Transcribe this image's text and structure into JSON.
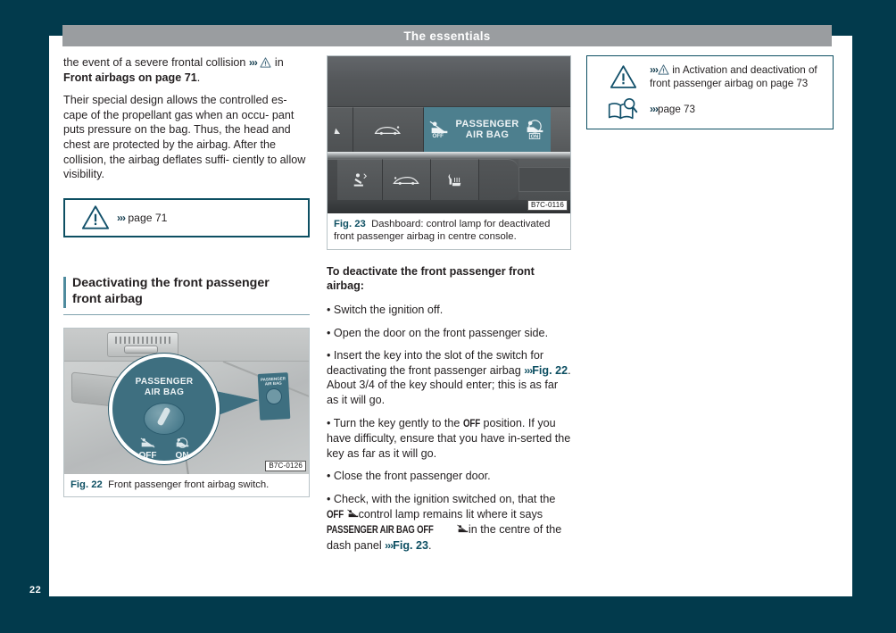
{
  "header": {
    "title": "The essentials"
  },
  "footer": {
    "page_number": "22"
  },
  "colors": {
    "page_background": "#023a4c",
    "paper": "#ffffff",
    "header_band": "#9a9da0",
    "accent_teal": "#0d4f62",
    "heading_rule": "#7fa2ad",
    "lamp_teal": "#4d7f8e"
  },
  "left_column": {
    "paragraphs": [
      {
        "id": "p1",
        "parts": [
          {
            "type": "text",
            "value": "the event of a severe frontal collision "
          },
          {
            "type": "chevron",
            "value": "›››"
          },
          {
            "type": "icon",
            "name": "warning-triangle-icon"
          },
          {
            "type": "text",
            "value": " in "
          },
          {
            "type": "bold",
            "value": "Front airbags on page 71"
          },
          {
            "type": "text",
            "value": "."
          }
        ],
        "plain": "the event of a severe frontal collision ››› ⚠ in Front airbags on page 71."
      },
      {
        "id": "p2",
        "plain": "Their special design allows the controlled es-cape of the propellant gas when an occu-pant puts pressure on the bag. Thus, the head and chest are protected by the airbag. After the collision, the airbag deflates suffi-ciently to allow visibility."
      }
    ],
    "p2_lines": [
      "Their special design allows the controlled es-",
      "cape of the propellant gas when an occu-",
      "pant puts pressure on the bag. Thus, the",
      "head and chest are protected by the airbag.",
      "After the collision, the airbag deflates suffi-",
      "ciently to allow visibility."
    ],
    "warning_box": {
      "icon": "warning-triangle-icon",
      "chevron": "›››",
      "text": "page 71"
    },
    "section_heading": {
      "line1": "Deactivating the front passenger",
      "line2": "front airbag"
    },
    "figure_22": {
      "code_tag": "B7C-0126",
      "caption_number": "Fig. 22",
      "caption_text": "Front passenger front airbag switch.",
      "artwork": {
        "callout_title_line1": "PASSENGER",
        "callout_title_line2": "AIR BAG",
        "label_off": "OFF",
        "label_on": "ON",
        "mini_switch_line1": "PASSENGER",
        "mini_switch_line2": "AIR BAG"
      }
    }
  },
  "middle_column": {
    "figure_23": {
      "code_tag": "B7C-0116",
      "caption_number": "Fig. 23",
      "caption_text": "Dashboard: control lamp for deactivated front passenger airbag in centre console.",
      "artwork": {
        "lamp_line1": "PASSENGER",
        "lamp_line2": "AIR BAG",
        "lamp_off_badge": "OFF",
        "lamp_on_badge": "ON",
        "row1_buttons": [
          "hazard-icon",
          "boot-lid-icon"
        ],
        "row2_buttons": [
          "child-seat-icon",
          "bonnet-icon",
          "seat-heater-icon",
          "blank-button"
        ]
      }
    },
    "intro_heading_line1": "To deactivate the front passenger front",
    "intro_heading_line2": "airbag:",
    "bullets": [
      {
        "id": "b1",
        "text": "Switch the ignition off."
      },
      {
        "id": "b2",
        "text": "Open the door on the front passenger side."
      },
      {
        "id": "b3",
        "text": "Insert the key into the slot of the switch for deactivating the front passenger airbag ››› Fig. 22. About 3/4 of the key should enter; this is as far as it will go.",
        "link": "Fig. 22"
      },
      {
        "id": "b4",
        "text": "Turn the key gently to the OFF position. If you have difficulty, ensure that you have inserted the key as far as it will go.",
        "chip": "OFF"
      },
      {
        "id": "b5",
        "text": "Close the front passenger door."
      },
      {
        "id": "b6",
        "text": "Check, with the ignition switched on, that the OFF ⚠ control lamp remains lit where it says PASSENGER AIR BAG OFF ⚠ in the centre of the dash panel ››› Fig. 23.",
        "chip": "OFF",
        "chip2": "PASSENGER AIR BAG OFF",
        "link": "Fig. 23"
      }
    ],
    "bullet_marker": "•",
    "chip_off": "OFF",
    "chip_pab_off": "PASSENGER AIR BAG OFF",
    "link_fig22": "Fig. 22",
    "link_fig23": "Fig. 23",
    "chevron": "›››"
  },
  "right_column": {
    "note_box": {
      "rows": [
        {
          "icon": "warning-triangle-icon",
          "chevron": "›››",
          "inline_icon": "warning-triangle-icon",
          "line1": " in Activation and deactivation of",
          "line2": "front passenger airbag on page 73",
          "text": "in Activation and deactivation of front passenger airbag on page 73"
        },
        {
          "icon": "book-magnifier-icon",
          "chevron": "›››",
          "text": "page 73"
        }
      ]
    }
  }
}
